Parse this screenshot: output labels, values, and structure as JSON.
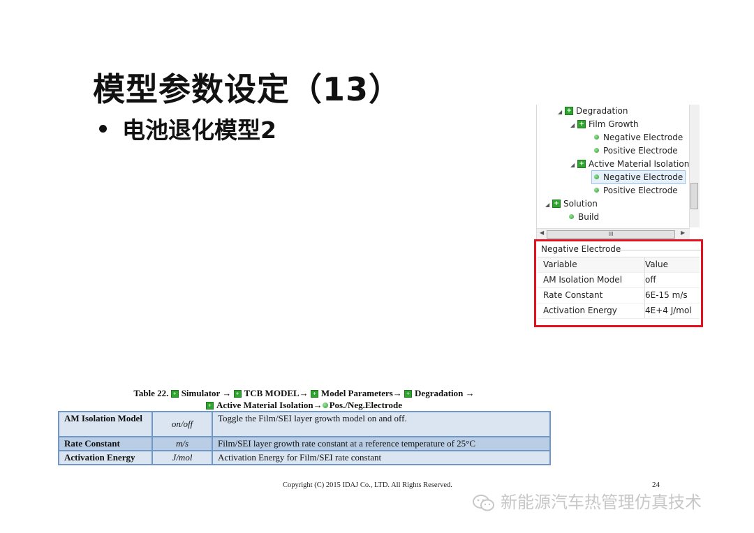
{
  "slide": {
    "title": "模型参数设定（13）",
    "bullet": "电池退化模型2"
  },
  "tree": {
    "items": [
      {
        "label": "Degradation",
        "type": "folder"
      },
      {
        "label": "Film Growth",
        "type": "folder"
      },
      {
        "label": "Negative Electrode",
        "type": "leaf"
      },
      {
        "label": "Positive Electrode",
        "type": "leaf"
      },
      {
        "label": "Active Material Isolation",
        "type": "folder"
      },
      {
        "label": "Negative Electrode",
        "type": "leaf",
        "selected": true
      },
      {
        "label": "Positive Electrode",
        "type": "leaf"
      },
      {
        "label": "Solution",
        "type": "folder"
      },
      {
        "label": "Build",
        "type": "leaf"
      }
    ],
    "hscroll_thumb": "III"
  },
  "properties": {
    "group_title": "Negative Electrode",
    "columns": [
      "Variable",
      "Value"
    ],
    "rows": [
      [
        "AM Isolation Model",
        "off"
      ],
      [
        "Rate Constant",
        "6E-15 m/s"
      ],
      [
        "Activation Energy",
        "4E+4 J/mol"
      ]
    ],
    "highlight_color": "#e8101c"
  },
  "doc_table": {
    "caption_prefix": "Table 22.",
    "path1": [
      "Simulator →",
      "TCB MODEL→",
      "Model Parameters→",
      "Degradation →"
    ],
    "path2": [
      "Active Material Isolation→",
      "Pos./Neg.Electrode"
    ],
    "rows": [
      {
        "name": "AM Isolation Model",
        "unit": "on/off",
        "desc": "Toggle the Film/SEI layer growth model on and off."
      },
      {
        "name": "Rate Constant",
        "unit": "m/s",
        "desc": "Film/SEI layer growth rate constant at a reference temperature of 25°C"
      },
      {
        "name": "Activation Energy",
        "unit": "J/mol",
        "desc": "Activation Energy for Film/SEI rate constant"
      }
    ],
    "border_color": "#6f98c8"
  },
  "footer": {
    "copyright": "Copyright (C) 2015 IDAJ Co., LTD. All Rights Reserved.",
    "page": "24"
  },
  "watermark": {
    "text": "新能源汽车热管理仿真技术",
    "icon": "wechat-icon"
  }
}
